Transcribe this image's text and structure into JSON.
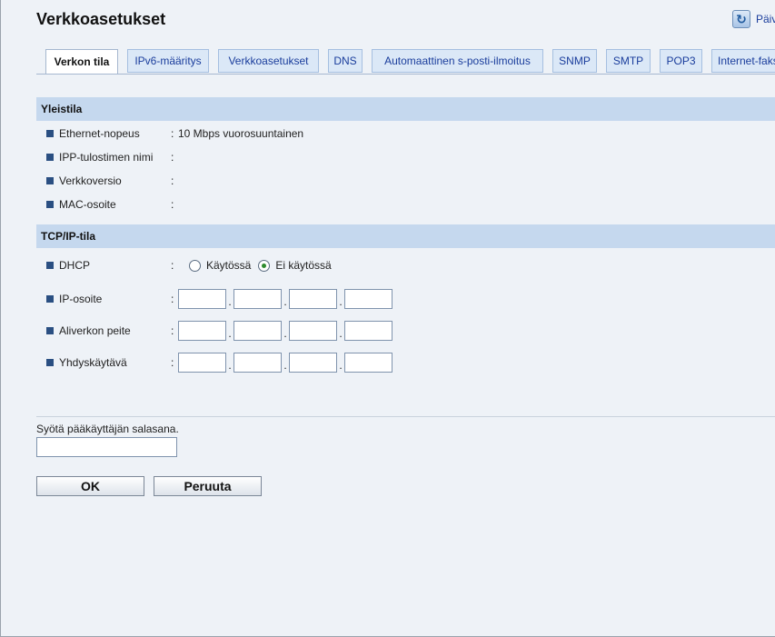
{
  "header": {
    "title": "Verkkoasetukset",
    "refresh_label": "Päivitä"
  },
  "tabs": [
    {
      "label": "Verkon tila",
      "active": true
    },
    {
      "label": "IPv6-määritys",
      "active": false
    },
    {
      "label": "Verkkoasetukset",
      "active": false
    },
    {
      "label": "DNS",
      "active": false
    },
    {
      "label": "Automaattinen s-posti-ilmoitus",
      "active": false
    },
    {
      "label": "SNMP",
      "active": false
    },
    {
      "label": "SMTP",
      "active": false
    },
    {
      "label": "POP3",
      "active": false
    },
    {
      "label": "Internet-faksi",
      "active": false
    }
  ],
  "general": {
    "title": "Yleistila",
    "rows": [
      {
        "label": "Ethernet-nopeus",
        "value": "10 Mbps vuorosuuntainen"
      },
      {
        "label": "IPP-tulostimen nimi",
        "value": ""
      },
      {
        "label": "Verkkoversio",
        "value": ""
      },
      {
        "label": "MAC-osoite",
        "value": ""
      }
    ]
  },
  "tcpip": {
    "title": "TCP/IP-tila",
    "dhcp": {
      "label": "DHCP",
      "options": [
        {
          "label": "Käytössä",
          "checked": false
        },
        {
          "label": "Ei käytössä",
          "checked": true
        }
      ]
    },
    "ip_address": {
      "label": "IP-osoite",
      "octets": [
        "",
        "",
        "",
        ""
      ]
    },
    "subnet_mask": {
      "label": "Aliverkon peite",
      "octets": [
        "",
        "",
        "",
        ""
      ]
    },
    "gateway": {
      "label": "Yhdyskäytävä",
      "octets": [
        "",
        "",
        "",
        ""
      ]
    }
  },
  "password": {
    "prompt": "Syötä pääkäyttäjän salasana.",
    "value": ""
  },
  "buttons": {
    "ok": "OK",
    "cancel": "Peruuta"
  },
  "colors": {
    "section_header": "#c5d8ee",
    "tab_bg": "#dbe8f7",
    "link": "#1a3d9c",
    "bullet": "#2a4f82",
    "radio_checked": "#2e8b2e"
  }
}
